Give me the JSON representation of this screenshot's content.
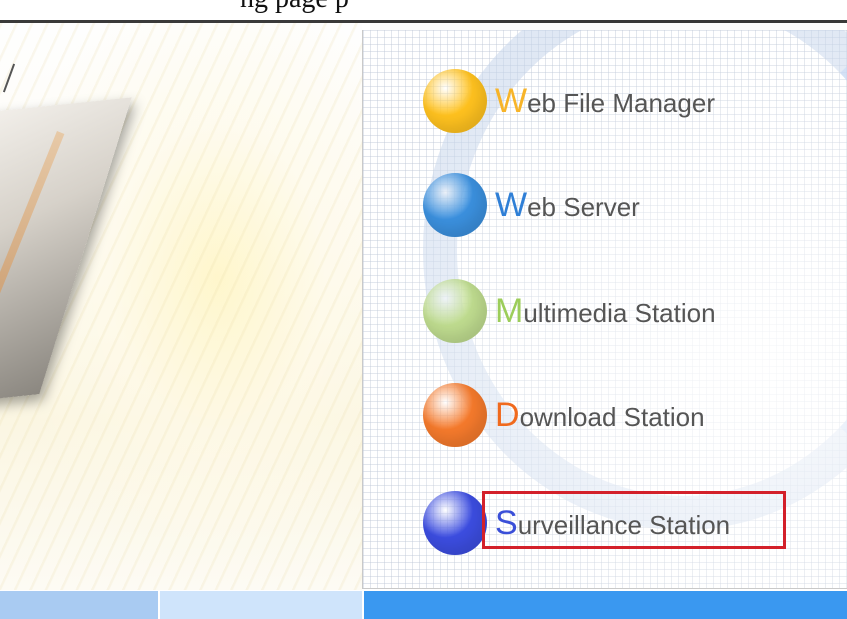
{
  "page": {
    "top_caption_fragment": "ng              page              p"
  },
  "menu": {
    "items": [
      {
        "initial": "W",
        "rest": "eb File Manager",
        "color": "#f7b429",
        "orb": "#ffc21f"
      },
      {
        "initial": "W",
        "rest": "eb Server",
        "color": "#2f7fd6",
        "orb": "#3b90de"
      },
      {
        "initial": "M",
        "rest": "ultimedia Station",
        "color": "#9ccd5a",
        "orb": "#bfdc8f"
      },
      {
        "initial": "D",
        "rest": "ownload Station",
        "color": "#f06a1e",
        "orb": "#f57a2c"
      },
      {
        "initial": "S",
        "rest": "urveillance Station",
        "color": "#3a4fd8",
        "orb": "#3c4de0",
        "highlighted": true
      }
    ]
  },
  "colors": {
    "highlight_border": "#d3202a",
    "label_text": "#555555",
    "bottom_bar": [
      "#a9cbf2",
      "#cfe4fb",
      "#3a98f0"
    ]
  },
  "icons": [
    "yellow-orb-icon",
    "blue-orb-icon",
    "green-orb-icon",
    "orange-orb-icon",
    "indigo-orb-icon"
  ]
}
